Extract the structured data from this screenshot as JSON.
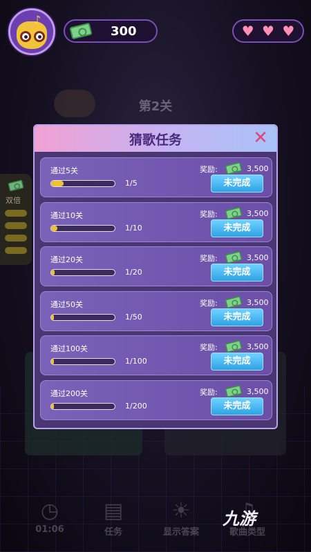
{
  "header": {
    "coins": "300",
    "hearts": [
      "♥",
      "♥",
      "♥"
    ]
  },
  "background": {
    "level_label": "第2关"
  },
  "side_panel": {
    "label": "双倍"
  },
  "dialog": {
    "title": "猜歌任务",
    "close_symbol": "✕",
    "tasks": [
      {
        "name": "通过5关",
        "progress_text": "1/5",
        "progress": 0.2,
        "reward_label": "奖励:",
        "reward": "3,500",
        "status": "未完成"
      },
      {
        "name": "通过10关",
        "progress_text": "1/10",
        "progress": 0.1,
        "reward_label": "奖励:",
        "reward": "3,500",
        "status": "未完成"
      },
      {
        "name": "通过20关",
        "progress_text": "1/20",
        "progress": 0.05,
        "reward_label": "奖励:",
        "reward": "3,500",
        "status": "未完成"
      },
      {
        "name": "通过50关",
        "progress_text": "1/50",
        "progress": 0.02,
        "reward_label": "奖励:",
        "reward": "3,500",
        "status": "未完成"
      },
      {
        "name": "通过100关",
        "progress_text": "1/100",
        "progress": 0.01,
        "reward_label": "奖励:",
        "reward": "3,500",
        "status": "未完成"
      },
      {
        "name": "通过200关",
        "progress_text": "1/200",
        "progress": 0.005,
        "reward_label": "奖励:",
        "reward": "3,500",
        "status": "未完成"
      }
    ]
  },
  "bottom_bar": {
    "items": [
      {
        "label": "01:06",
        "icon": "clock-icon"
      },
      {
        "label": "任务",
        "icon": "clipboard-icon"
      },
      {
        "label": "显示答案",
        "icon": "lightbulb-icon"
      },
      {
        "label": "歌曲类型",
        "icon": "music-note-icon"
      }
    ]
  },
  "watermark": "九游",
  "colors": {
    "dialog_bg": "#4a3672",
    "progress_fill": "#f2c12e",
    "status_button": "#2fa2e6",
    "close": "#e0457e"
  }
}
